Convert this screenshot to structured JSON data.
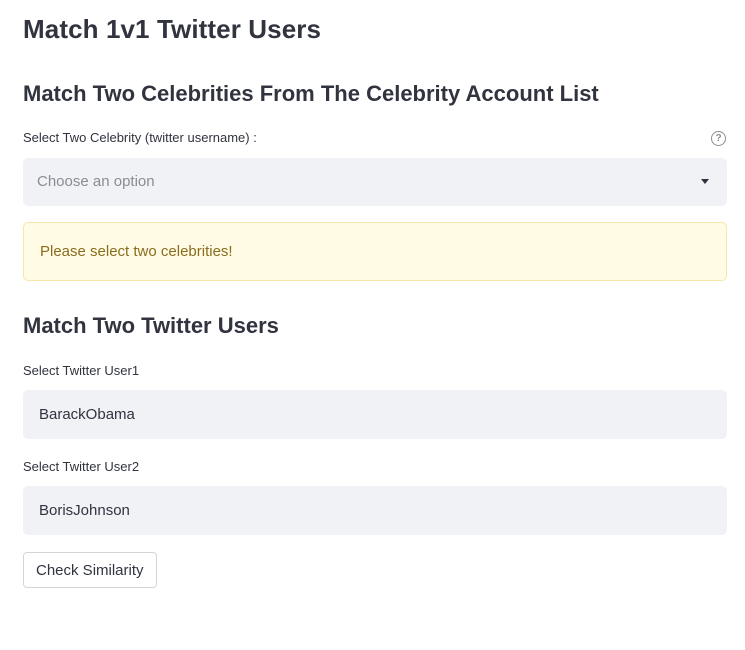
{
  "page": {
    "title": "Match 1v1 Twitter Users"
  },
  "celebrity_section": {
    "title": "Match Two Celebrities From The Celebrity Account List",
    "select_label": "Select Two Celebrity (twitter username) :",
    "select_placeholder": "Choose an option",
    "help_icon": "question-circle-icon",
    "warning_message": "Please select two celebrities!"
  },
  "users_section": {
    "title": "Match Two Twitter Users",
    "user1_label": "Select Twitter User1",
    "user1_value": "BarackObama",
    "user2_label": "Select Twitter User2",
    "user2_value": "BorisJohnson",
    "check_button_label": "Check Similarity"
  },
  "colors": {
    "input_background": "#f0f2f6",
    "warning_background": "#fffbe5",
    "warning_text": "#8a6d1e",
    "text": "#31333f"
  }
}
